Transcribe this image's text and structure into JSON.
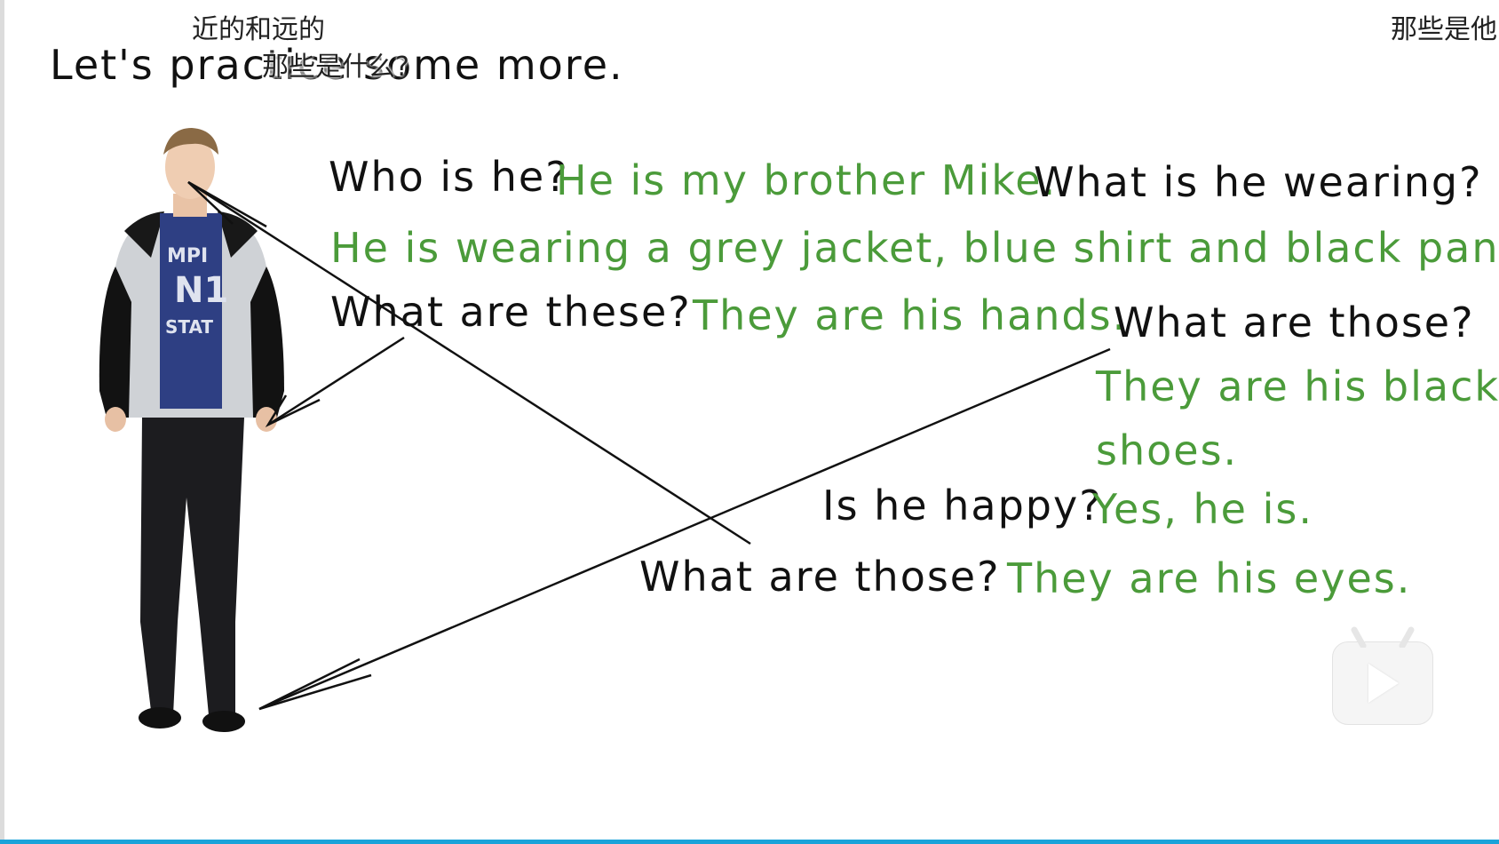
{
  "slide": {
    "title": "Let's practice some more.",
    "subtitles": {
      "line1": "近的和远的",
      "line2": "那些是什么?",
      "right": "那些是他"
    },
    "dialog": [
      {
        "q": "Who is he?",
        "a": "He is my brother Mike."
      },
      {
        "q": "What is he wearing?",
        "a": "He is wearing a grey jacket, blue shirt and black pants."
      },
      {
        "q": "What are these?",
        "a": "They are his hands."
      },
      {
        "q": "What are those?",
        "a1": "They are his black",
        "a2": "shoes."
      },
      {
        "q": "Is he happy?",
        "a": "Yes, he is."
      },
      {
        "q": "What are those?",
        "a": "They are his eyes."
      }
    ]
  },
  "colors": {
    "question": "#111111",
    "answer": "#4b9b3a",
    "progress": "#1aa3d9"
  },
  "icons": {
    "play": "play-icon"
  }
}
